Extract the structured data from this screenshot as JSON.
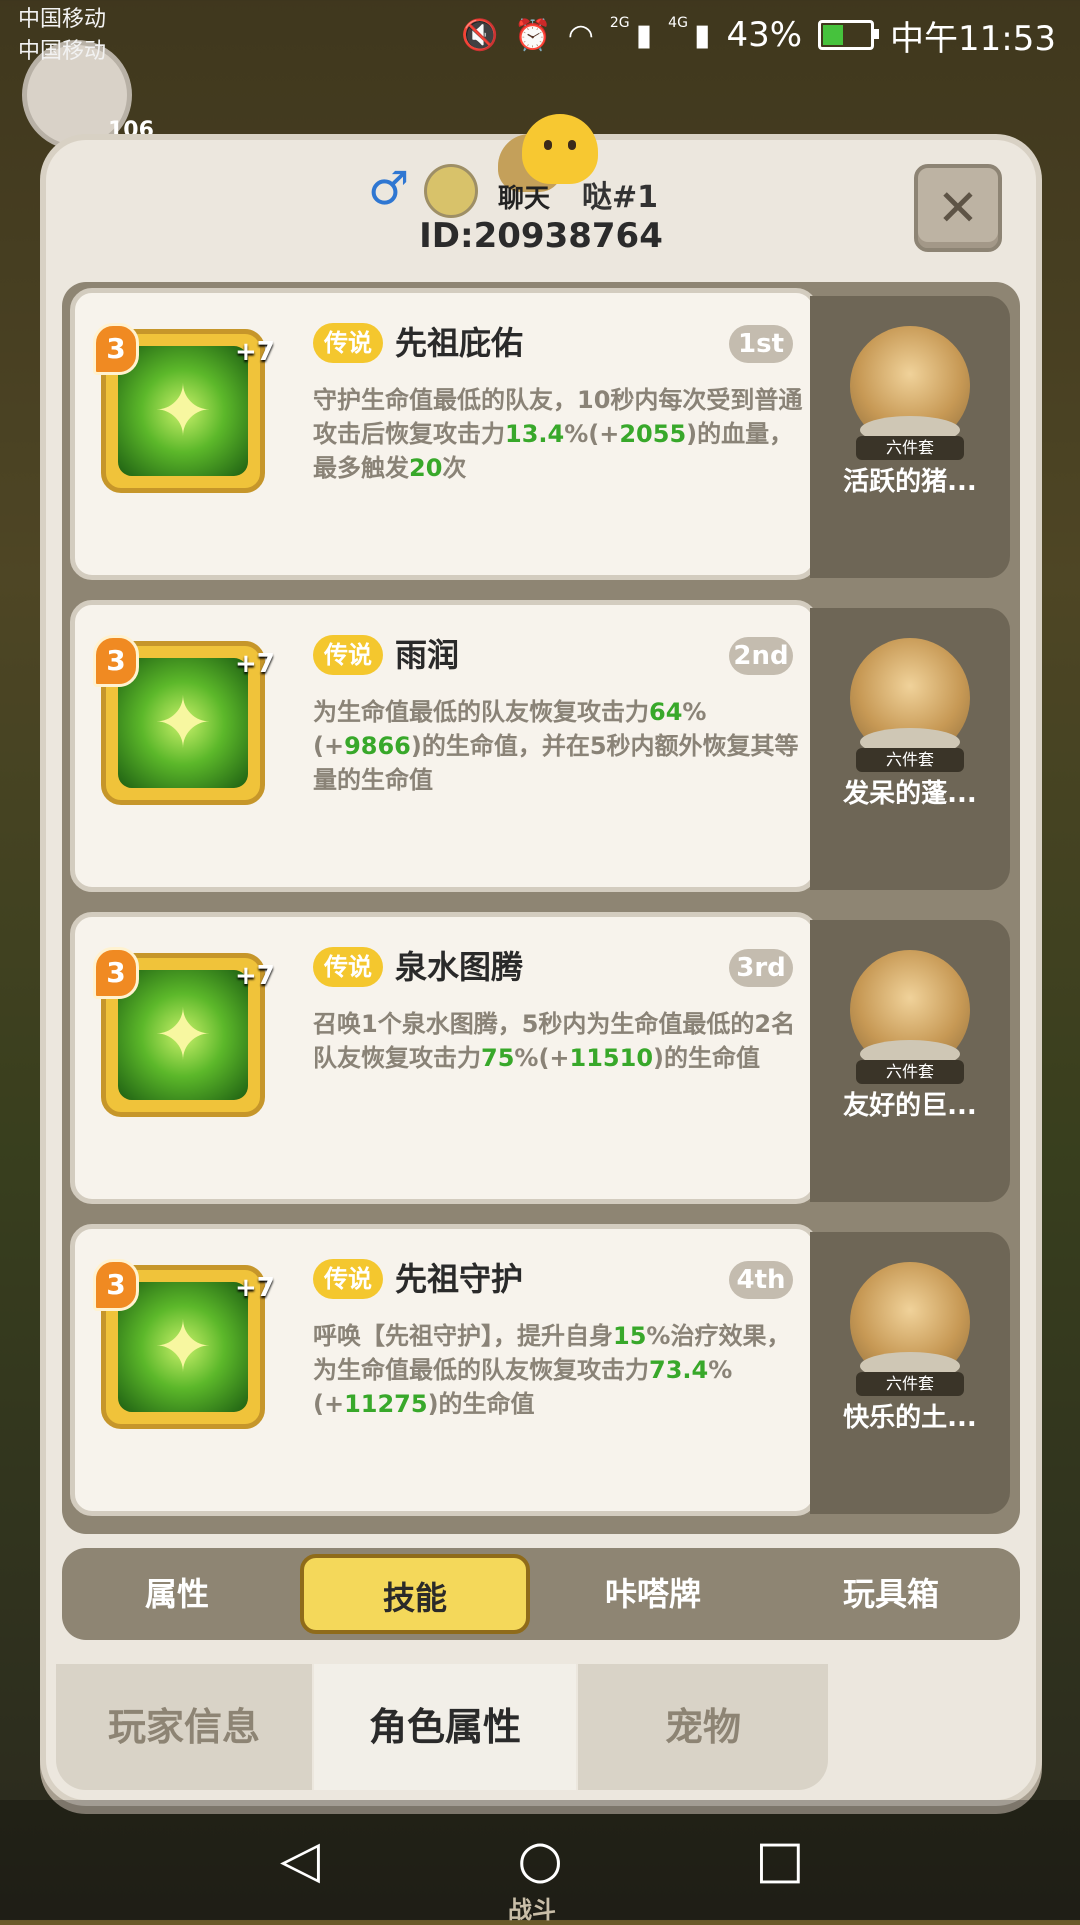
{
  "status_bar": {
    "carrier_1": "中国移动",
    "carrier_2": "中国移动",
    "mute_icon": "mute-icon",
    "alarm_icon": "alarm-icon",
    "wifi_icon": "wifi-icon",
    "signal_2g": "2G",
    "signal_4g": "4G",
    "battery_pct": "43%",
    "time": "中午11:53"
  },
  "hud": {
    "level": "106"
  },
  "header": {
    "gender": "♂",
    "chat_label": "聊天",
    "player_name": "哒#1",
    "player_id": "ID:20938764",
    "close_label": "✕"
  },
  "skills": [
    {
      "level": "3",
      "plus": "+7",
      "rarity": "传说",
      "name": "先祖庇佑",
      "rank": "1st",
      "desc": [
        {
          "t": "守护生命值最低的队友，10秒内每次受到普通攻击后恢复攻击力"
        },
        {
          "t": "13.4",
          "hl": true
        },
        {
          "t": "%(+"
        },
        {
          "t": "2055",
          "hl": true
        },
        {
          "t": ")的血量，最多触发"
        },
        {
          "t": "20",
          "hl": true
        },
        {
          "t": "次"
        }
      ],
      "icon": "shield-icon",
      "pet": {
        "set": "六件套",
        "name": "活跃的猪..."
      }
    },
    {
      "level": "3",
      "plus": "+7",
      "rarity": "传说",
      "name": "雨润",
      "rank": "2nd",
      "desc": [
        {
          "t": "为生命值最低的队友恢复攻击力"
        },
        {
          "t": "64",
          "hl": true
        },
        {
          "t": "%(+"
        },
        {
          "t": "9866",
          "hl": true
        },
        {
          "t": ")的生命值，并在5秒内额外恢复其等量的生命值"
        }
      ],
      "icon": "heal-cross-icon",
      "pet": {
        "set": "六件套",
        "name": "发呆的蓬..."
      }
    },
    {
      "level": "3",
      "plus": "+7",
      "rarity": "传说",
      "name": "泉水图腾",
      "rank": "3rd",
      "desc": [
        {
          "t": "召唤1个泉水图腾，5秒内为生命值最低的2名队友恢复攻击力"
        },
        {
          "t": "75",
          "hl": true
        },
        {
          "t": "%(+"
        },
        {
          "t": "11510",
          "hl": true
        },
        {
          "t": ")的生命值"
        }
      ],
      "icon": "totem-icon",
      "pet": {
        "set": "六件套",
        "name": "友好的巨..."
      }
    },
    {
      "level": "3",
      "plus": "+7",
      "rarity": "传说",
      "name": "先祖守护",
      "rank": "4th",
      "desc": [
        {
          "t": "呼唤【先祖守护】，提升自身"
        },
        {
          "t": "15",
          "hl": true
        },
        {
          "t": "%治疗效果，为生命值最低的队友恢复攻击力"
        },
        {
          "t": "73.4",
          "hl": true
        },
        {
          "t": "%(+"
        },
        {
          "t": "11275",
          "hl": true
        },
        {
          "t": ")的生命值"
        }
      ],
      "icon": "guardian-icon",
      "pet": {
        "set": "六件套",
        "name": "快乐的土..."
      }
    }
  ],
  "subtabs": [
    {
      "label": "属性",
      "active": false
    },
    {
      "label": "技能",
      "active": true
    },
    {
      "label": "咔嗒牌",
      "active": false
    },
    {
      "label": "玩具箱",
      "active": false
    }
  ],
  "bottomtabs": [
    {
      "label": "玩家信息",
      "active": false
    },
    {
      "label": "角色属性",
      "active": true
    },
    {
      "label": "宠物",
      "active": false
    }
  ],
  "navbar": {
    "back_icon": "back-triangle-icon",
    "home_icon": "home-circle-icon",
    "recents_icon": "recents-square-icon",
    "game_label": "战斗"
  },
  "colors": {
    "highlight": "#38a82a",
    "rarity": "#f4c72e",
    "active_tab": "#f4d85a"
  }
}
